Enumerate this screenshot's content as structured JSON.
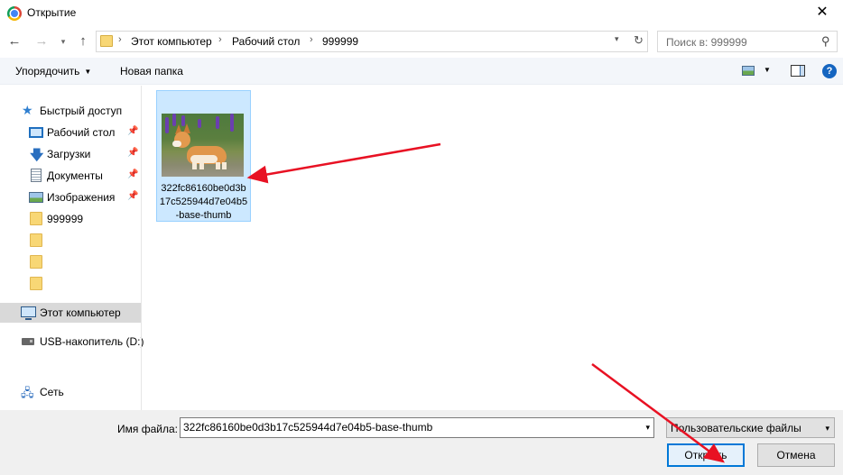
{
  "window": {
    "title": "Открытие",
    "close_glyph": "✕"
  },
  "nav": {
    "back": "←",
    "forward": "→",
    "recent": "▾",
    "up": "↑"
  },
  "address": {
    "crumbs": [
      "Этот компьютер",
      "Рабочий стол",
      "999999"
    ],
    "sep": "›",
    "drop": "▾",
    "refresh": "↻"
  },
  "search": {
    "placeholder": "Поиск в: 999999"
  },
  "toolbar": {
    "organize": "Упорядочить",
    "new_folder": "Новая папка",
    "help": "?"
  },
  "sidebar": {
    "quick_access": "Быстрый доступ",
    "desktop": "Рабочий стол",
    "downloads": "Загрузки",
    "documents": "Документы",
    "images": "Изображения",
    "folder_999999": "999999",
    "this_pc": "Этот компьютер",
    "usb": "USB-накопитель (D:)",
    "network": "Сеть"
  },
  "files": [
    {
      "name": "322fc86160be0d3b17c525944d7e04b5-base-thumb",
      "selected": true
    }
  ],
  "bottom": {
    "filename_label": "Имя файла:",
    "filename_value": "322fc86160be0d3b17c525944d7e04b5-base-thumb",
    "filetype": "Пользовательские файлы",
    "open_button": "Открыть",
    "cancel_button": "Отмена"
  },
  "colors": {
    "accent": "#0078d7",
    "selection": "#cce8ff",
    "annotation": "#e81123"
  }
}
